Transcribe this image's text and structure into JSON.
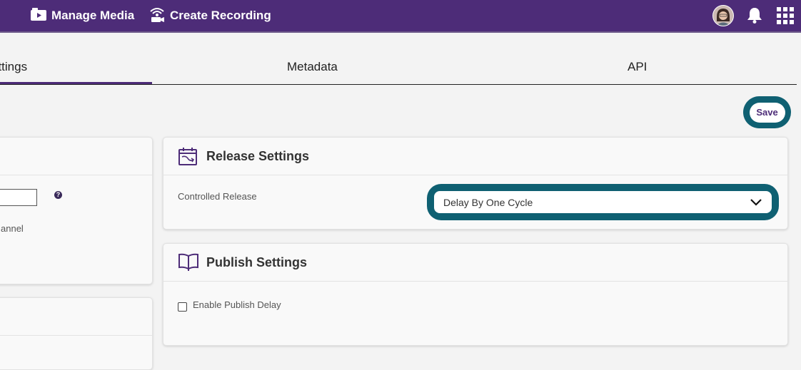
{
  "topbar": {
    "manage_media": "Manage Media",
    "create_recording": "Create Recording",
    "bg_color": "#4d2c78"
  },
  "tabs": {
    "settings": "ettings",
    "metadata": "Metadata",
    "api": "API"
  },
  "save_label": "Save",
  "left_card": {
    "channel_text": "annel",
    "help": "?"
  },
  "release": {
    "title": "Release Settings",
    "controlled_release_label": "Controlled Release",
    "selected": "Delay By One Cycle"
  },
  "publish": {
    "title": "Publish Settings",
    "enable_delay_label": "Enable Publish Delay"
  },
  "colors": {
    "accent": "#4d2c78",
    "focus_ring": "#0f6072"
  },
  "icons": [
    "media-icon",
    "recording-icon",
    "bell-icon",
    "apps-grid-icon",
    "calendar-icon",
    "book-icon",
    "chevron-down-icon",
    "help-icon"
  ]
}
